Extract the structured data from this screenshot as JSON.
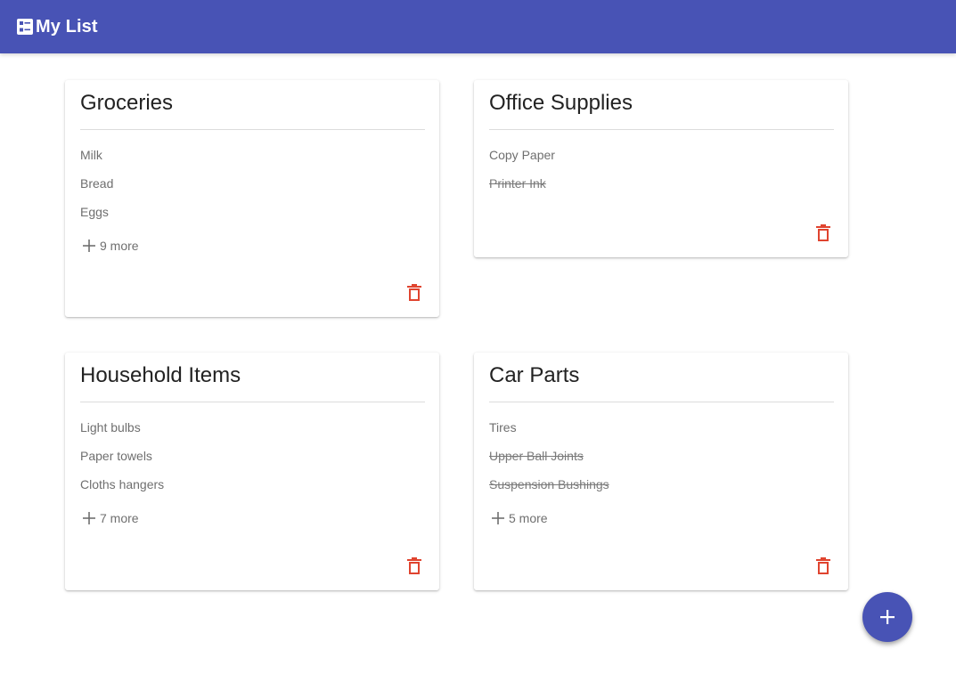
{
  "appbar": {
    "title": "My List",
    "icon": "list-view-icon",
    "color": "#4853b5"
  },
  "lists": [
    {
      "title": "Groceries",
      "items": [
        {
          "label": "Milk",
          "done": false
        },
        {
          "label": "Bread",
          "done": false
        },
        {
          "label": "Eggs",
          "done": false
        }
      ],
      "more_label": "9 more"
    },
    {
      "title": "Office Supplies",
      "items": [
        {
          "label": "Copy Paper",
          "done": false
        },
        {
          "label": "Printer Ink",
          "done": true
        }
      ],
      "more_label": ""
    },
    {
      "title": "Household Items",
      "items": [
        {
          "label": "Light bulbs",
          "done": false
        },
        {
          "label": "Paper towels",
          "done": false
        },
        {
          "label": "Cloths hangers",
          "done": false
        }
      ],
      "more_label": "7 more"
    },
    {
      "title": "Car Parts",
      "items": [
        {
          "label": "Tires",
          "done": false
        },
        {
          "label": "Upper Ball Joints",
          "done": true
        },
        {
          "label": "Suspension Bushings",
          "done": true
        }
      ],
      "more_label": "5 more"
    }
  ],
  "delete_icon": "trash-icon",
  "delete_color": "#e0442f",
  "fab": {
    "icon": "plus-icon",
    "color": "#4853b5"
  }
}
